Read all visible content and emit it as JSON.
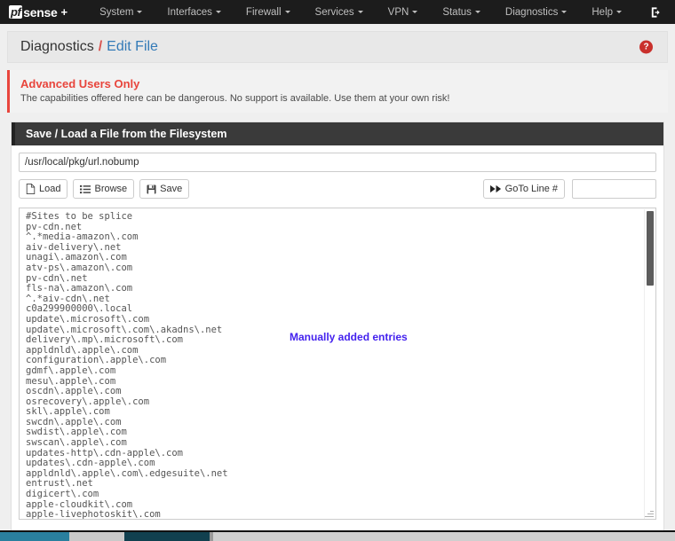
{
  "navbar": {
    "brand_mark": "pf",
    "brand_text": "sense",
    "brand_plus": "+",
    "items": [
      {
        "label": "System",
        "icon": "chevron-down-icon"
      },
      {
        "label": "Interfaces",
        "icon": "chevron-down-icon"
      },
      {
        "label": "Firewall",
        "icon": "chevron-down-icon"
      },
      {
        "label": "Services",
        "icon": "chevron-down-icon"
      },
      {
        "label": "VPN",
        "icon": "chevron-down-icon"
      },
      {
        "label": "Status",
        "icon": "chevron-down-icon"
      },
      {
        "label": "Diagnostics",
        "icon": "chevron-down-icon"
      },
      {
        "label": "Help",
        "icon": "chevron-down-icon"
      }
    ],
    "logout_icon": "logout-icon"
  },
  "breadcrumb": {
    "root": "Diagnostics",
    "separator": "/",
    "leaf": "Edit File",
    "help_icon": "help-circle-icon",
    "help_label": "?"
  },
  "warning": {
    "title": "Advanced Users Only",
    "body": "The capabilities offered here can be dangerous. No support is available. Use them at your own risk!",
    "accent_color": "#e8453c"
  },
  "panel": {
    "title": "Save / Load a File from the Filesystem",
    "path_value": "/usr/local/pkg/url.nobump",
    "path_placeholder": "",
    "buttons": [
      {
        "label": "Load",
        "icon": "file-icon"
      },
      {
        "label": "Browse",
        "icon": "list-icon"
      },
      {
        "label": "Save",
        "icon": "floppy-disk-icon"
      }
    ],
    "goto": {
      "button_label": "GoTo Line #",
      "button_icon": "fast-forward-icon",
      "input_value": "",
      "input_placeholder": ""
    }
  },
  "editor": {
    "annotation": "Manually added entries",
    "annotation_color": "#4422ee",
    "content": "#Sites to be splice\npv-cdn.net\n^.*media-amazon\\.com\naiv-delivery\\.net\nunagi\\.amazon\\.com\natv-ps\\.amazon\\.com\npv-cdn\\.net\nfls-na\\.amazon\\.com\n^.*aiv-cdn\\.net\nc0a299900000\\.local\nupdate\\.microsoft\\.com\nupdate\\.microsoft\\.com\\.akadns\\.net\ndelivery\\.mp\\.microsoft\\.com\nappldnld\\.apple\\.com\nconfiguration\\.apple\\.com\ngdmf\\.apple\\.com\nmesu\\.apple\\.com\noscdn\\.apple\\.com\nosrecovery\\.apple\\.com\nskl\\.apple\\.com\nswcdn\\.apple\\.com\nswdist\\.apple\\.com\nswscan\\.apple\\.com\nupdates-http\\.cdn-apple\\.com\nupdates\\.cdn-apple\\.com\nappldnld\\.apple\\.com\\.edgesuite\\.net\nentrust\\.net\ndigicert\\.com\napple-cloudkit\\.com\napple-livephotoskit\\.com"
  }
}
